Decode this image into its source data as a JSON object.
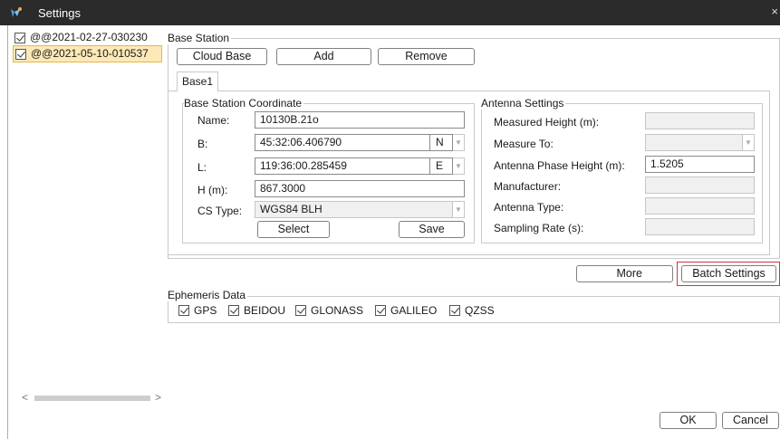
{
  "window": {
    "title": "Settings",
    "close_glyph": "×"
  },
  "tree": {
    "items": [
      {
        "label": "@@2021-02-27-030230",
        "checked": true,
        "selected": false
      },
      {
        "label": "@@2021-05-10-010537",
        "checked": true,
        "selected": true
      }
    ]
  },
  "scrollbar": {
    "left_arrow": "<",
    "right_arrow": ">"
  },
  "base_station": {
    "group_label": "Base Station",
    "buttons": {
      "cloud_base": "Cloud Base",
      "add": "Add",
      "remove": "Remove"
    },
    "tab": "Base1",
    "coordinate": {
      "group_label": "Base Station Coordinate",
      "name_label": "Name:",
      "name_value": "10130B.21o",
      "b_label": "B:",
      "b_value": "45:32:06.406790",
      "b_hemisphere": "N",
      "l_label": "L:",
      "l_value": "119:36:00.285459",
      "l_hemisphere": "E",
      "h_label": "H (m):",
      "h_value": "867.3000",
      "cs_label": "CS Type:",
      "cs_value": "WGS84 BLH",
      "select_button": "Select",
      "save_button": "Save"
    },
    "antenna": {
      "group_label": "Antenna Settings",
      "measured_height_label": "Measured Height (m):",
      "measured_height_value": "",
      "measure_to_label": "Measure To:",
      "measure_to_value": "",
      "phase_height_label": "Antenna Phase Height (m):",
      "phase_height_value": "1.5205",
      "manufacturer_label": "Manufacturer:",
      "manufacturer_value": "",
      "antenna_type_label": "Antenna Type:",
      "antenna_type_value": "",
      "sampling_rate_label": "Sampling Rate (s):",
      "sampling_rate_value": ""
    }
  },
  "actions": {
    "more": "More",
    "batch_settings": "Batch Settings"
  },
  "ephemeris": {
    "group_label": "Ephemeris Data",
    "systems": [
      {
        "label": "GPS",
        "checked": true
      },
      {
        "label": "BEIDOU",
        "checked": true
      },
      {
        "label": "GLONASS",
        "checked": true
      },
      {
        "label": "GALILEO",
        "checked": true
      },
      {
        "label": "QZSS",
        "checked": true
      }
    ]
  },
  "footer": {
    "ok": "OK",
    "cancel": "Cancel"
  },
  "colors": {
    "titlebar": "#2b2b2b",
    "selection_bg": "#fde9b6",
    "highlight_border": "#d0363a"
  }
}
